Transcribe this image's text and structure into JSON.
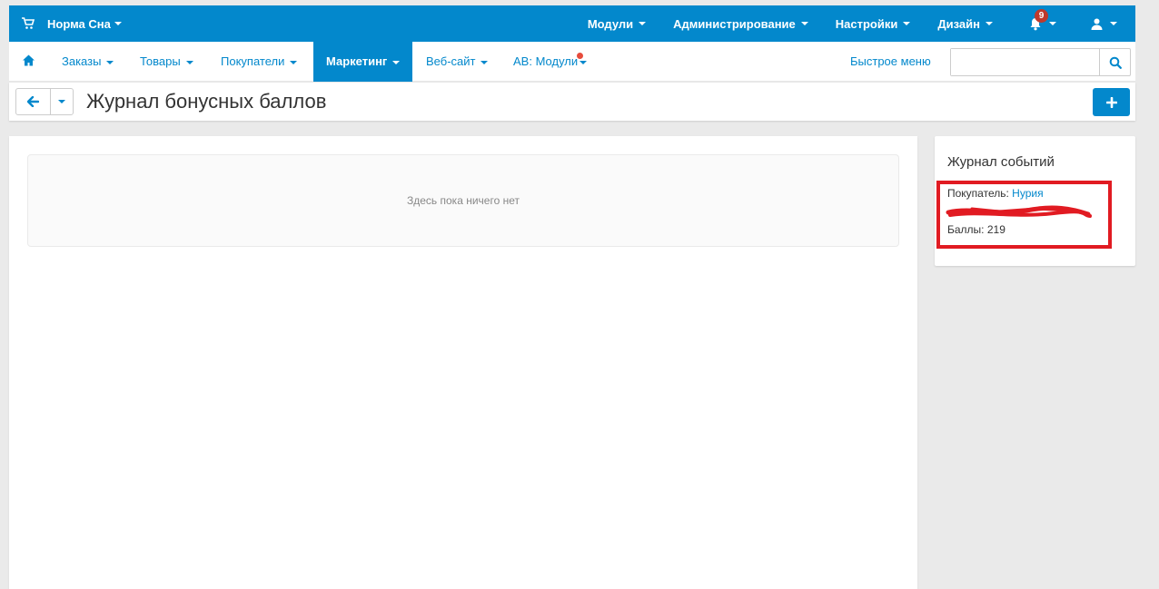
{
  "topbar": {
    "brand": "Норма Сна",
    "menu": [
      "Модули",
      "Администрирование",
      "Настройки",
      "Дизайн"
    ],
    "notifications_count": "9"
  },
  "nav": {
    "items": [
      "Заказы",
      "Товары",
      "Покупатели",
      "Маркетинг",
      "Веб-сайт",
      "АВ: Модули"
    ],
    "active": "Маркетинг",
    "quick_menu": "Быстрое меню",
    "search_value": ""
  },
  "page": {
    "title": "Журнал бонусных баллов"
  },
  "main": {
    "empty_text": "Здесь пока ничего нет"
  },
  "sidebar": {
    "title": "Журнал событий",
    "customer_label": "Покупатель:",
    "customer_name": "Нурия",
    "points_label": "Баллы:",
    "points_value": "219"
  },
  "colors": {
    "accent": "#0388cc",
    "highlight_annotation": "#e11b22",
    "badge": "#c0392b"
  }
}
